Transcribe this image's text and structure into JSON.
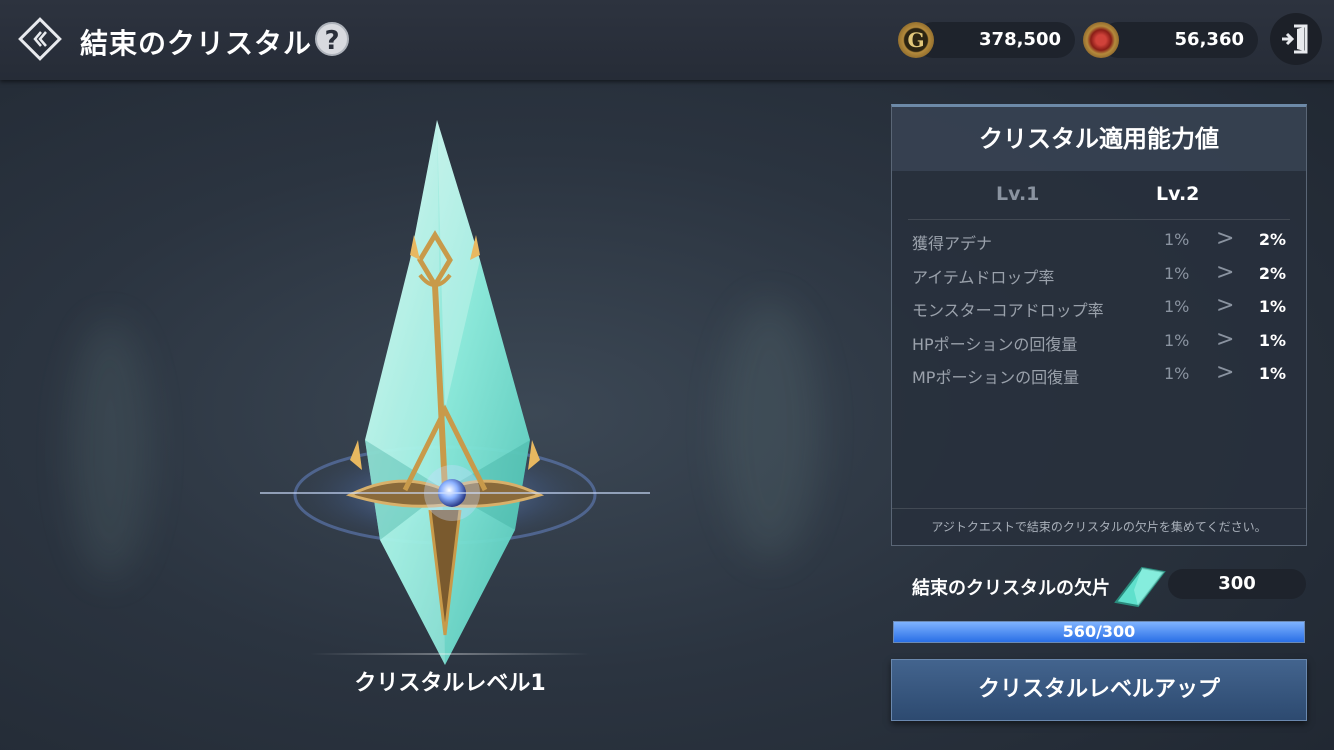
{
  "header": {
    "title": "結束のクリスタル",
    "help_label": "?",
    "gold_icon_letter": "G",
    "gold": "378,500",
    "gem": "56,360"
  },
  "crystal": {
    "level_label": "クリスタルレベル1"
  },
  "panel": {
    "title": "クリスタル適用能力値",
    "current_level": "Lv.1",
    "next_level": "Lv.2",
    "stats": [
      {
        "name": "獲得アデナ",
        "from": "1%",
        "arrow": ">",
        "to": "2%"
      },
      {
        "name": "アイテムドロップ率",
        "from": "1%",
        "arrow": ">",
        "to": "2%"
      },
      {
        "name": "モンスターコアドロップ率",
        "from": "1%",
        "arrow": ">",
        "to": "1%"
      },
      {
        "name": "HPポーションの回復量",
        "from": "1%",
        "arrow": ">",
        "to": "1%"
      },
      {
        "name": "MPポーションの回復量",
        "from": "1%",
        "arrow": ">",
        "to": "1%"
      }
    ],
    "note": "アジトクエストで結束のクリスタルの欠片を集めてください。"
  },
  "shards": {
    "label": "結束のクリスタルの欠片",
    "count": "300",
    "progress_text": "560/300",
    "progress_fraction": 1.0
  },
  "actions": {
    "level_up_label": "クリスタルレベルアップ"
  },
  "colors": {
    "accent_blue": "#2a6fe6",
    "crystal_cyan": "#8ff0e0",
    "gold_trim": "#c89a4a"
  },
  "icons": {
    "back": "back-chevron-icon",
    "help": "help-icon",
    "gold": "gold-coin-icon",
    "gem": "red-gem-icon",
    "exit": "exit-door-icon",
    "shard": "crystal-shard-icon"
  }
}
